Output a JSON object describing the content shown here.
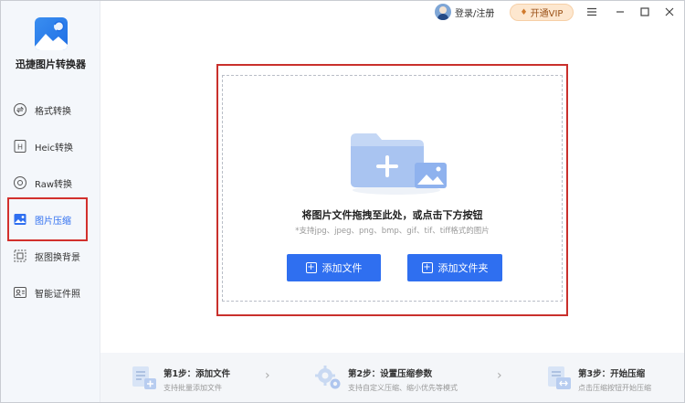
{
  "app": {
    "title": "迅捷图片转换器"
  },
  "sidebar": {
    "items": [
      {
        "label": "格式转换",
        "icon": "format-convert-icon"
      },
      {
        "label": "Heic转换",
        "icon": "heic-icon"
      },
      {
        "label": "Raw转换",
        "icon": "raw-icon"
      },
      {
        "label": "图片压缩",
        "icon": "image-compress-icon",
        "active": true
      },
      {
        "label": "抠图换背景",
        "icon": "cutout-icon"
      },
      {
        "label": "智能证件照",
        "icon": "id-photo-icon"
      }
    ]
  },
  "topbar": {
    "user_label": "登录/注册",
    "vip_label": "开通VIP",
    "vip_icon": "diamond-icon"
  },
  "dropzone": {
    "title": "将图片文件拖拽至此处，或点击下方按钮",
    "subtitle": "*支持jpg、jpeg、png、bmp、gif、tif、tiff格式的图片",
    "add_file_label": "添加文件",
    "add_folder_label": "添加文件夹"
  },
  "steps": [
    {
      "title": "第1步：添加文件",
      "desc": "支持批量添加文件"
    },
    {
      "title": "第2步：设置压缩参数",
      "desc": "支持自定义压缩、缩小优先等模式"
    },
    {
      "title": "第3步：开始压缩",
      "desc": "点击压缩按钮开始压缩"
    }
  ],
  "colors": {
    "accent": "#2f6ff0",
    "highlight_border": "#d2302d",
    "vip_bg": "#fde7cf"
  }
}
